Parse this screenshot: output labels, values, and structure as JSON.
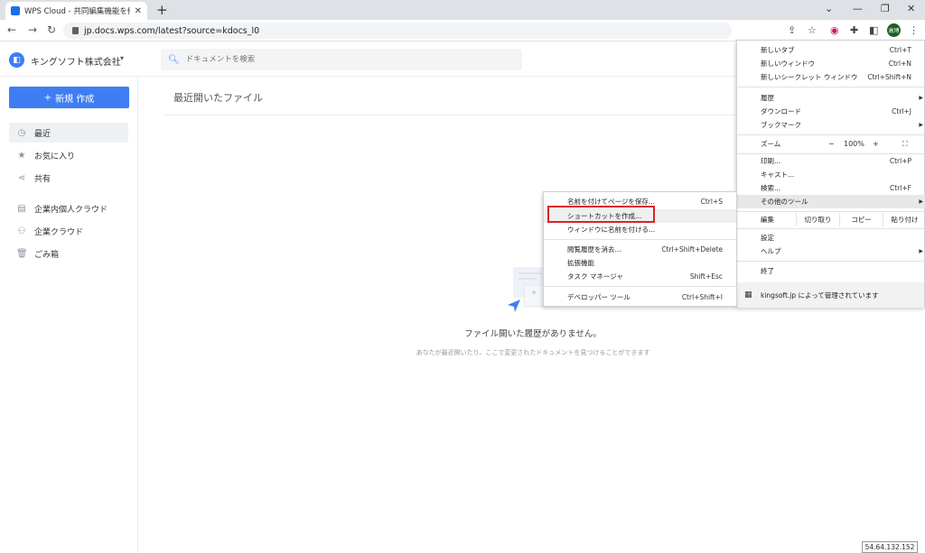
{
  "browser": {
    "tab_title": "WPS Cloud - 共同編集機能を備え",
    "tab_close": "✕",
    "new_tab": "+",
    "url": "jp.docs.wps.com/latest?source=kdocs_l0",
    "avatar_text": "高博",
    "window": {
      "chevron": "⌄",
      "min": "—",
      "max": "❐",
      "close": "✕"
    },
    "nav": {
      "back": "←",
      "forward": "→",
      "reload": "↻"
    }
  },
  "app": {
    "org_logo": "◧",
    "org_name": "キングソフト株式会社",
    "org_caret": "▾",
    "search_placeholder": "ドキュメントを検索",
    "new_button": "新規 作成",
    "new_button_icon": "+",
    "nav_items": [
      {
        "label": "最近",
        "icon": "◷"
      },
      {
        "label": "お気に入り",
        "icon": "★"
      },
      {
        "label": "共有",
        "icon": "⋖"
      },
      {
        "label": "企業内個人クラウド",
        "icon": "▤"
      },
      {
        "label": "企業クラウド",
        "icon": "⚇"
      },
      {
        "label": "ごみ箱",
        "icon": "🗑"
      }
    ],
    "content_title": "最近開いたファイル",
    "empty_title": "ファイル開いた履歴がありません。",
    "empty_subtitle": "あなたが最近開いたり、ここで変更されたドキュメントを見つけることができます"
  },
  "chrome_menu": {
    "items": [
      {
        "label": "新しいタブ",
        "shortcut": "Ctrl+T"
      },
      {
        "label": "新しいウィンドウ",
        "shortcut": "Ctrl+N"
      },
      {
        "label": "新しいシークレット ウィンドウ",
        "shortcut": "Ctrl+Shift+N"
      },
      {
        "label": "履歴",
        "shortcut": ""
      },
      {
        "label": "ダウンロード",
        "shortcut": "Ctrl+J"
      },
      {
        "label": "ブックマーク",
        "shortcut": ""
      },
      {
        "label": "印刷...",
        "shortcut": "Ctrl+P"
      },
      {
        "label": "キャスト...",
        "shortcut": ""
      },
      {
        "label": "検索...",
        "shortcut": "Ctrl+F"
      },
      {
        "label": "その他のツール",
        "shortcut": ""
      },
      {
        "label": "設定",
        "shortcut": ""
      },
      {
        "label": "ヘルプ",
        "shortcut": ""
      },
      {
        "label": "終了",
        "shortcut": ""
      }
    ],
    "zoom": {
      "label": "ズーム",
      "minus": "−",
      "value": "100%",
      "plus": "+",
      "fullscreen": "⛶"
    },
    "edit": {
      "label": "編集",
      "cut": "切り取り",
      "copy": "コピー",
      "paste": "貼り付け"
    },
    "managed": "kingsoft.jp によって管理されています",
    "arrow": "▶"
  },
  "sub_menu": {
    "items": [
      {
        "label": "名前を付けてページを保存...",
        "shortcut": "Ctrl+S"
      },
      {
        "label": "ショートカットを作成...",
        "shortcut": ""
      },
      {
        "label": "ウィンドウに名前を付ける...",
        "shortcut": ""
      },
      {
        "label": "閲覧履歴を消去...",
        "shortcut": "Ctrl+Shift+Delete"
      },
      {
        "label": "拡張機能",
        "shortcut": ""
      },
      {
        "label": "タスク マネージャ",
        "shortcut": "Shift+Esc"
      },
      {
        "label": "デベロッパー ツール",
        "shortcut": "Ctrl+Shift+I"
      }
    ]
  },
  "status": {
    "ip": "54.64.132.152"
  },
  "colors": {
    "accent": "#3f7ef2",
    "highlight_box": "#d22222"
  }
}
